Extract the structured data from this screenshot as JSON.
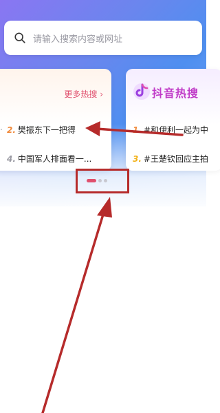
{
  "search": {
    "placeholder": "请输入搜索内容或网址"
  },
  "hot_card": {
    "more_label": "更多热搜",
    "more_chevron": "›",
    "items": [
      {
        "rank": "2.",
        "text": "樊振东下一把得"
      },
      {
        "rank": "4.",
        "text": "中国军人排面看一..."
      }
    ]
  },
  "douyin_card": {
    "title": "抖音热搜",
    "items": [
      {
        "rank": "1.",
        "text": "#和伊利一起为中"
      },
      {
        "rank": "3.",
        "text": "#王楚钦回应主拍"
      }
    ]
  },
  "left_edge_dot": ".",
  "carousel": {
    "pages": 3,
    "active_index": 0
  },
  "colors": {
    "accent": "#e0506e",
    "annotation": "#b62b2b",
    "header_gradient_start": "#8a76f2",
    "header_gradient_end": "#4f8ff0"
  }
}
